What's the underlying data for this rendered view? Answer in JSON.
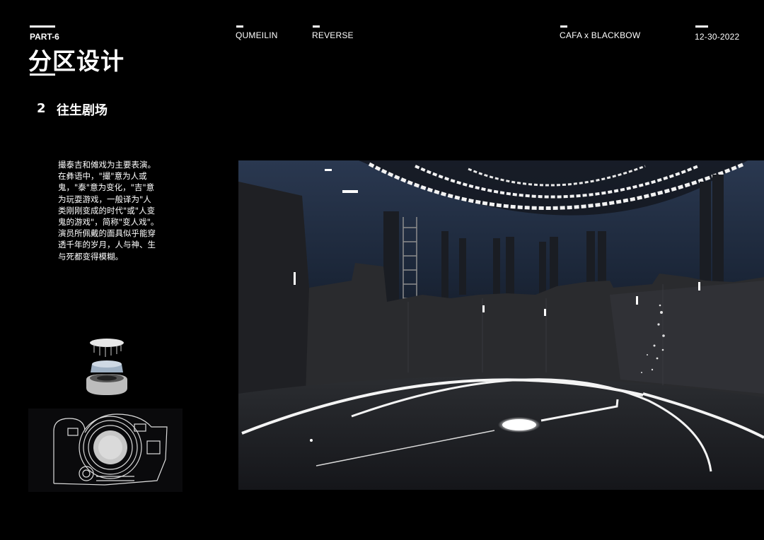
{
  "header": {
    "part": "PART-6",
    "title": "分区设计",
    "author": "QUMEILIN",
    "project": "REVERSE",
    "org": "CAFA x BLACKBOW",
    "date": "12-30-2022"
  },
  "section": {
    "number": "2",
    "title": "往生剧场"
  },
  "description": {
    "lines": [
      "撮泰吉和傩戏为主要表演。",
      "在彝语中，\"撮\"意为人或",
      "鬼，\"泰\"意为变化，\"吉\"意",
      "为玩耍游戏，一般译为\"人",
      "类刚刚变成的时代\"或\"人变",
      "鬼的游戏\"，简称\"变人戏\"。",
      "演员所佩戴的面具似乎能穿",
      "透千年的岁月，人与神、生",
      "与死都变得模糊。"
    ]
  },
  "colors": {
    "background": "#000000",
    "text": "#ffffff",
    "light": "#ffffff",
    "sky": "#2a3850"
  }
}
